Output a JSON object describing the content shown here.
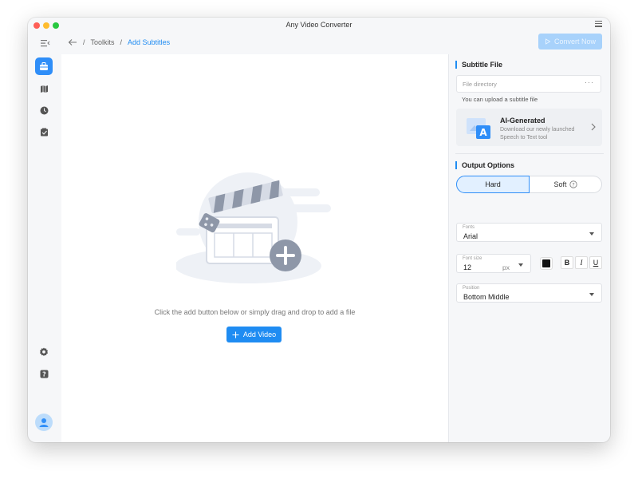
{
  "window": {
    "title": "Any Video Converter"
  },
  "breadcrumb": {
    "parent": "Toolkits",
    "separator": "/",
    "current": "Add Subtitles"
  },
  "toolbar": {
    "convert_label": "Convert Now"
  },
  "sidebar": {
    "items": [
      {
        "name": "toolkit-icon",
        "active": true
      },
      {
        "name": "map-icon",
        "active": false
      },
      {
        "name": "history-clock-icon",
        "active": false
      },
      {
        "name": "tasks-check-icon",
        "active": false
      }
    ],
    "bottom": [
      "settings-gear-icon",
      "help-question-icon",
      "user-avatar-icon"
    ]
  },
  "main": {
    "hint": "Click the add button below or simply drag and drop to add a file",
    "add_video_label": "Add Video"
  },
  "subtitle_file": {
    "title": "Subtitle File",
    "placeholder": "File directory",
    "browse_label": "···",
    "note": "You can upload a subtitle file"
  },
  "ai_card": {
    "title": "AI-Generated",
    "description": "Download our newly launched Speech to Text tool",
    "thumb_letter": "A"
  },
  "output_options": {
    "title": "Output Options",
    "modes": {
      "hard": "Hard",
      "soft": "Soft",
      "selected": "hard"
    },
    "fonts": {
      "label": "Fonts",
      "value": "Arial"
    },
    "font_size": {
      "label": "Font size",
      "value": "12",
      "unit": "px"
    },
    "color": "#111111",
    "format_buttons": {
      "bold": "B",
      "italic": "I",
      "underline": "U"
    },
    "position": {
      "label": "Position",
      "value": "Bottom Middle"
    }
  },
  "colors": {
    "accent": "#1f8cf2",
    "sidebar_active": "#2f8ef8",
    "disabled_button": "#a8d2fb"
  }
}
